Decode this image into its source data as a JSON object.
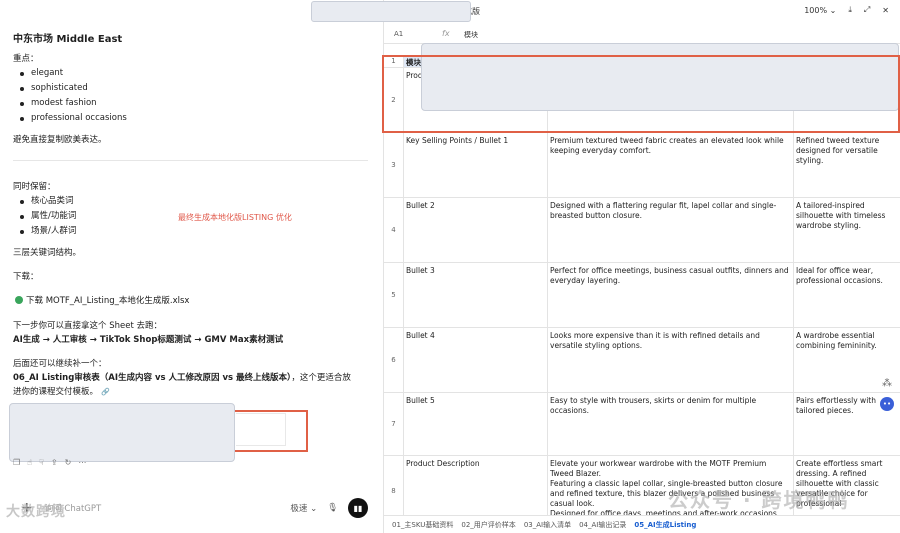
{
  "chat": {
    "heading": "中东市场 Middle East",
    "focus_label": "重点：",
    "focus_items": [
      "elegant",
      "sophisticated",
      "modest fashion",
      "professional occasions"
    ],
    "avoid_text": "避免直接复制欧美表达。",
    "keep_label": "同时保留：",
    "keep_items": [
      "核心品类词",
      "属性/功能词",
      "场景/人群词"
    ],
    "structure_text": "三层关键词结构。",
    "red_note": "最终生成本地化版LISTING 优化",
    "download_label": "下载：",
    "download_link": "下载 MOTF_AI_Listing_本地化生成版.xlsx",
    "next_step_text": "下一步你可以直接拿这个 Sheet 去跑：",
    "flow_text": "AI生成 → 人工审核 → TikTok Shop标题测试 → GMV Max素材测试",
    "later_text": "后面还可以继续补一个：",
    "later_bold_1": "06_AI Listing审核表（AI生成内容 vs 人工修改原因 vs 最终上线版本）",
    "later_rest_1": "，这个更适合放",
    "later_rest_2": "进你的课程交付模板。",
    "composer_placeholder": "询问 ChatGPT",
    "speed_label": "极速",
    "watermark": "大数跨境"
  },
  "sheet": {
    "title_suffix": "化生成版",
    "zoom": "100%",
    "cell_ref": "A1",
    "formula_value": "模块",
    "rows": [
      {
        "num": "1",
        "c1": "模块",
        "c2": "",
        "c3": ""
      },
      {
        "num": "2",
        "c1": "Produ",
        "c2": "",
        "c3": ""
      },
      {
        "num": "3",
        "c1": "Key Selling Points / Bullet 1",
        "c2": "Premium textured tweed fabric creates an elevated look while keeping everyday comfort.",
        "c3": "Refined tweed texture designed for versatile styling."
      },
      {
        "num": "4",
        "c1": "Bullet 2",
        "c2": "Designed with a flattering regular fit, lapel collar and single-breasted button closure.",
        "c3": "A tailored-inspired silhouette with timeless wardrobe styling."
      },
      {
        "num": "5",
        "c1": "Bullet 3",
        "c2": "Perfect for office meetings, business casual outfits, dinners and everyday layering.",
        "c3": "Ideal for office wear, professional occasions."
      },
      {
        "num": "6",
        "c1": "Bullet 4",
        "c2": "Looks more expensive than it is with refined details and versatile styling options.",
        "c3": "A wardrobe essential combining femininity."
      },
      {
        "num": "7",
        "c1": "Bullet 5",
        "c2": "Easy to style with trousers, skirts or denim for multiple occasions.",
        "c3": "Pairs effortlessly with tailored pieces."
      },
      {
        "num": "8",
        "c1": "Product Description",
        "c2": "Elevate your workwear wardrobe with the MOTF Premium Tweed Blazer.\nFeaturing a classic lapel collar, single-breasted button closure and refined texture, this blazer delivers a polished business casual look.\nDesigned for office days, meetings and after-work occasions,",
        "c3": "Create effortless smart dressing. A refined silhouette with classic versatile choice for professional"
      }
    ],
    "tabs": [
      "01_主SKU基础资料",
      "02_用户评价样本",
      "03_AI输入清单",
      "04_AI输出记录",
      "05_AI生成Listing"
    ],
    "active_tab": "05_AI生成Listing",
    "watermark": "公众号 · 跨境鸭鸭"
  }
}
